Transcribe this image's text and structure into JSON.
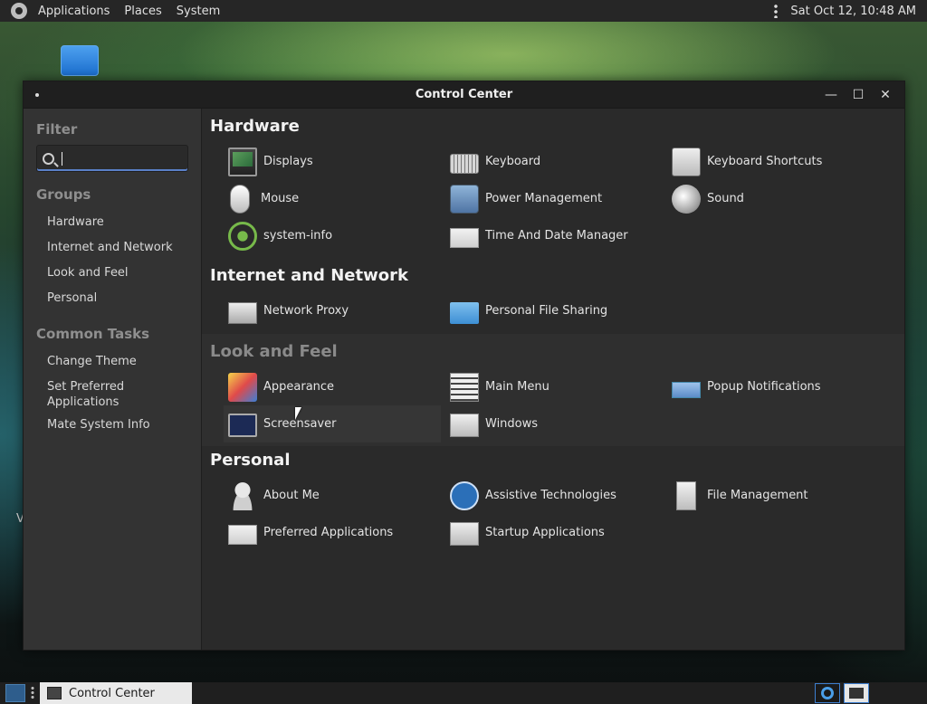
{
  "top_panel": {
    "menus": [
      "Applications",
      "Places",
      "System"
    ],
    "clock": "Sat Oct 12, 10:48 AM"
  },
  "desktop": {
    "stray_text": "V"
  },
  "window": {
    "title": "Control Center",
    "controls": {
      "minimize": "—",
      "maximize": "☐",
      "close": "✕"
    }
  },
  "sidebar": {
    "filter_heading": "Filter",
    "search": {
      "value": "",
      "placeholder": ""
    },
    "groups_heading": "Groups",
    "groups": [
      "Hardware",
      "Internet and Network",
      "Look and Feel",
      "Personal"
    ],
    "tasks_heading": "Common Tasks",
    "tasks": [
      "Change Theme",
      "Set Preferred Applications",
      "Mate System Info"
    ]
  },
  "groups": [
    {
      "title": "Hardware",
      "items": [
        {
          "label": "Displays",
          "icon": "display-icon"
        },
        {
          "label": "Keyboard",
          "icon": "keyboard-icon"
        },
        {
          "label": "Keyboard Shortcuts",
          "icon": "keyboard-shortcuts-icon"
        },
        {
          "label": "Mouse",
          "icon": "mouse-icon"
        },
        {
          "label": "Power Management",
          "icon": "power-management-icon"
        },
        {
          "label": "Sound",
          "icon": "sound-icon"
        },
        {
          "label": "system-info",
          "icon": "system-info-icon"
        },
        {
          "label": "Time And Date Manager",
          "icon": "time-date-icon"
        }
      ]
    },
    {
      "title": "Internet and Network",
      "items": [
        {
          "label": "Network Proxy",
          "icon": "network-proxy-icon"
        },
        {
          "label": "Personal File Sharing",
          "icon": "file-sharing-icon"
        }
      ]
    },
    {
      "title": "Look and Feel",
      "items": [
        {
          "label": "Appearance",
          "icon": "appearance-icon"
        },
        {
          "label": "Main Menu",
          "icon": "main-menu-icon"
        },
        {
          "label": "Popup Notifications",
          "icon": "popup-notifications-icon"
        },
        {
          "label": "Screensaver",
          "icon": "screensaver-icon"
        },
        {
          "label": "Windows",
          "icon": "windows-icon"
        }
      ]
    },
    {
      "title": "Personal",
      "items": [
        {
          "label": "About Me",
          "icon": "about-me-icon"
        },
        {
          "label": "Assistive Technologies",
          "icon": "assistive-technologies-icon"
        },
        {
          "label": "File Management",
          "icon": "file-management-icon"
        },
        {
          "label": "Preferred Applications",
          "icon": "preferred-applications-icon"
        },
        {
          "label": "Startup Applications",
          "icon": "startup-applications-icon"
        }
      ]
    }
  ],
  "taskbar": {
    "task_label": "Control Center"
  }
}
